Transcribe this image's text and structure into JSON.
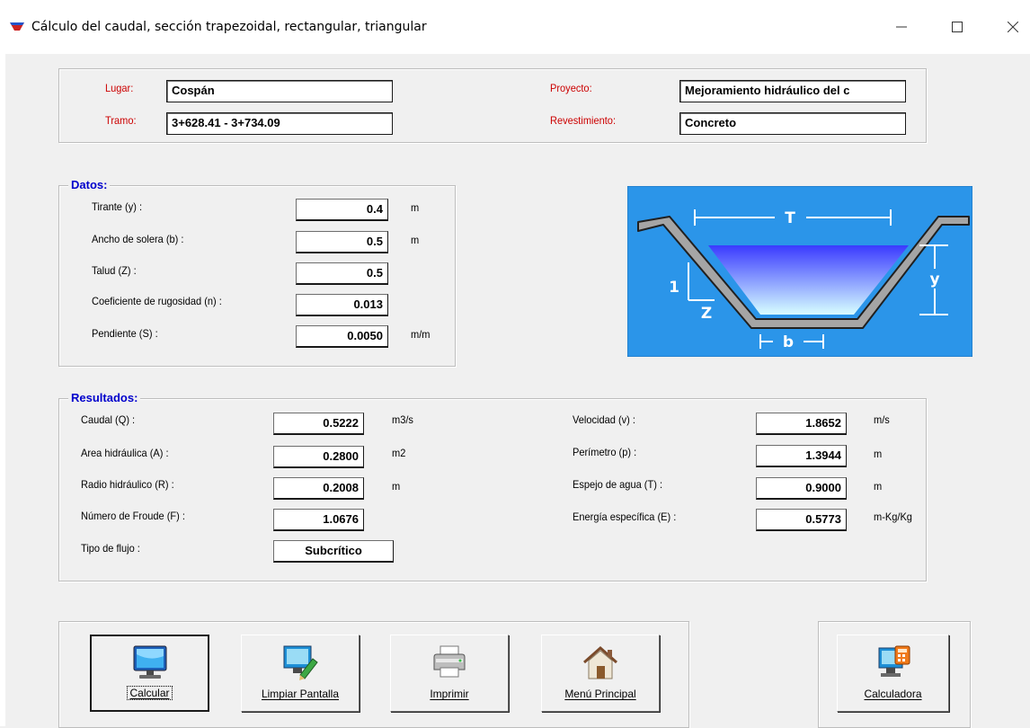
{
  "window": {
    "title": "Cálculo del caudal, sección trapezoidal, rectangular, triangular"
  },
  "header": {
    "lugar_label": "Lugar:",
    "lugar_value": "Cospán",
    "tramo_label": "Tramo:",
    "tramo_value": "3+628.41 - 3+734.09",
    "proyecto_label": "Proyecto:",
    "proyecto_value": "Mejoramiento hidráulico del c",
    "revestimiento_label": "Revestimiento:",
    "revestimiento_value": "Concreto"
  },
  "datos": {
    "title": "Datos:",
    "fields": [
      {
        "label": "Tirante (y) :",
        "value": "0.4",
        "unit": "m"
      },
      {
        "label": "Ancho de solera (b) :",
        "value": "0.5",
        "unit": "m"
      },
      {
        "label": "Talud  (Z) :",
        "value": "0.5",
        "unit": ""
      },
      {
        "label": "Coeficiente de rugosidad (n) :",
        "value": "0.013",
        "unit": ""
      },
      {
        "label": "Pendiente (S) :",
        "value": "0.0050",
        "unit": "m/m"
      }
    ]
  },
  "diagram": {
    "label_T": "T",
    "label_y": "y",
    "label_1": "1",
    "label_Z": "Z",
    "label_b": "b",
    "bg_color": "#2b95e9",
    "water_top": "#3a3aff",
    "water_bottom": "#d8ffff"
  },
  "resultados": {
    "title": "Resultados:",
    "left": [
      {
        "label": "Caudal (Q) :",
        "value": "0.5222",
        "unit": "m3/s"
      },
      {
        "label": "Area hidráulica (A) :",
        "value": "0.2800",
        "unit": "m2"
      },
      {
        "label": "Radio hidráulico (R) :",
        "value": "0.2008",
        "unit": "m"
      },
      {
        "label": "Número de Froude (F) :",
        "value": "1.0676",
        "unit": ""
      },
      {
        "label": "Tipo de flujo :",
        "value": "Subcrítico",
        "unit": ""
      }
    ],
    "right": [
      {
        "label": "Velocidad (v) :",
        "value": "1.8652",
        "unit": "m/s"
      },
      {
        "label": "Perímetro (p) :",
        "value": "1.3944",
        "unit": "m"
      },
      {
        "label": "Espejo de agua (T) :",
        "value": "0.9000",
        "unit": "m"
      },
      {
        "label": "Energía específica (E) :",
        "value": "0.5773",
        "unit": "m-Kg/Kg"
      }
    ]
  },
  "buttons": {
    "calcular": "Calcular",
    "limpiar": "Limpiar Pantalla",
    "imprimir": "Imprimir",
    "menu": "Menú Principal",
    "calculadora": "Calculadora"
  }
}
